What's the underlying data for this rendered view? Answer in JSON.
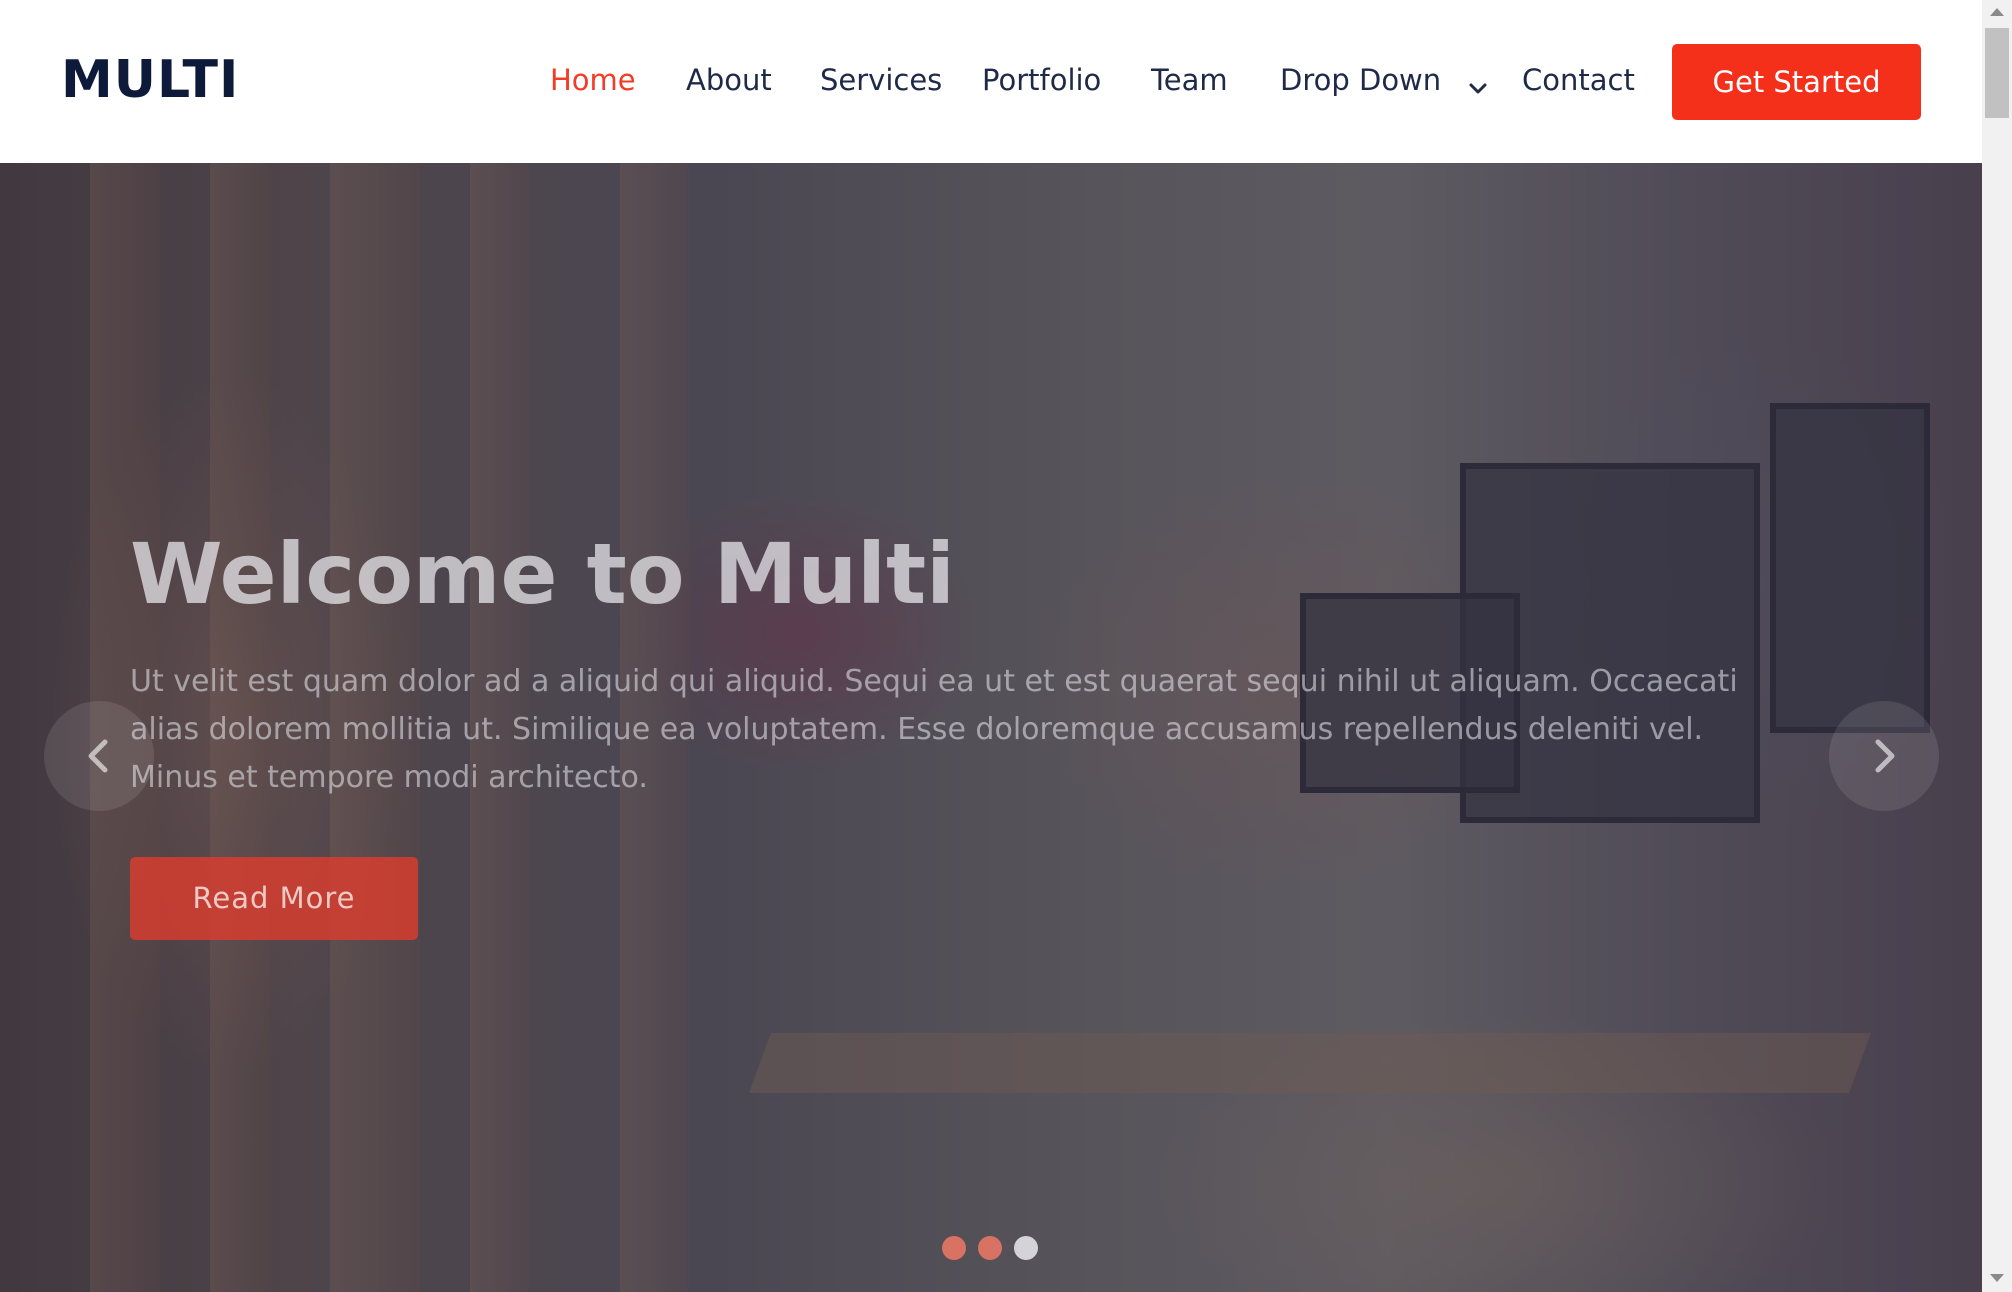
{
  "header": {
    "logo": "MULTI",
    "nav": [
      {
        "label": "Home",
        "active": true
      },
      {
        "label": "About",
        "active": false
      },
      {
        "label": "Services",
        "active": false
      },
      {
        "label": "Portfolio",
        "active": false
      },
      {
        "label": "Team",
        "active": false
      },
      {
        "label": "Drop Down",
        "active": false,
        "icon": "chevron-down-icon"
      },
      {
        "label": "Contact",
        "active": false
      }
    ],
    "cta_label": "Get Started"
  },
  "hero": {
    "title": "Welcome to Multi",
    "text": "Ut velit est quam dolor ad a aliquid qui aliquid. Sequi ea ut et est quaerat sequi nihil ut aliquam. Occaecati alias dolorem mollitia ut. Similique ea voluptatem. Esse doloremque accusamus repellendus deleniti vel. Minus et tempore modi architecto.",
    "read_more_label": "Read More",
    "prev_icon": "chevron-left-icon",
    "next_icon": "chevron-right-icon",
    "slides_count": 3,
    "active_slide": 3
  },
  "colors": {
    "accent": "#f4301b",
    "nav_text": "#1e2a47",
    "logo": "#0d1a3a"
  }
}
